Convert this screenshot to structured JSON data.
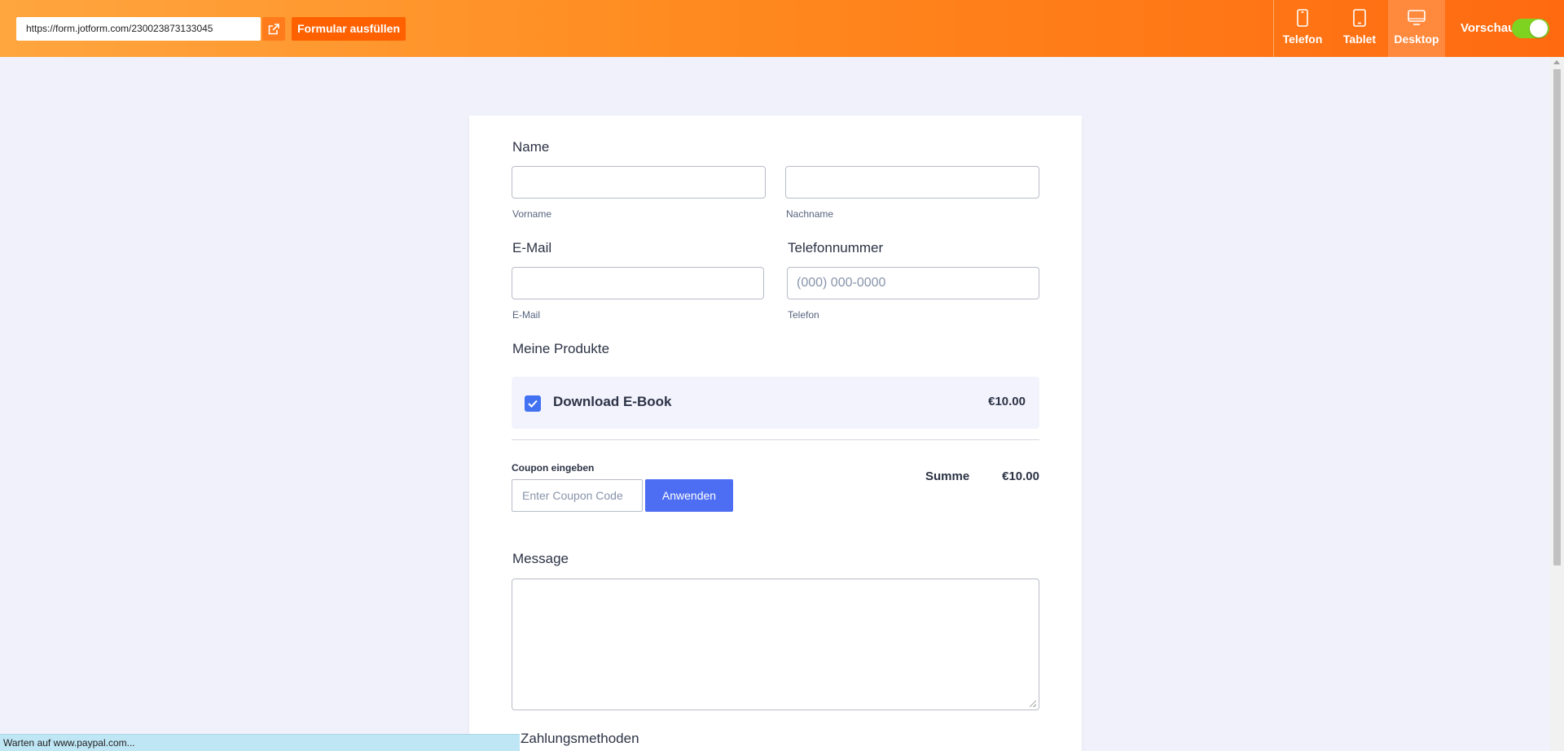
{
  "topbar": {
    "url": "https://form.jotform.com/230023873133045",
    "fill_button": "Formular ausfüllen",
    "devices": [
      {
        "label": "Telefon",
        "icon": "phone-icon",
        "active": false
      },
      {
        "label": "Tablet",
        "icon": "tablet-icon",
        "active": false
      },
      {
        "label": "Desktop",
        "icon": "desktop-icon",
        "active": true
      }
    ],
    "preview_label": "Vorschau",
    "preview_on": true,
    "colors": {
      "gradient_start": "#ffa63f",
      "gradient_end": "#ff6a10",
      "toggle_on": "#7ed321"
    }
  },
  "form": {
    "name": {
      "label": "Name",
      "first_sublabel": "Vorname",
      "last_sublabel": "Nachname",
      "first_value": "",
      "last_value": ""
    },
    "email": {
      "label": "E-Mail",
      "sublabel": "E-Mail",
      "value": ""
    },
    "phone": {
      "label": "Telefonnummer",
      "placeholder": "(000) 000-0000",
      "sublabel": "Telefon"
    },
    "products": {
      "label": "Meine Produkte",
      "items": [
        {
          "name": "Download E-Book",
          "price": "€10.00",
          "checked": true
        }
      ]
    },
    "coupon": {
      "label": "Coupon eingeben",
      "placeholder": "Enter Coupon Code",
      "apply_button": "Anwenden"
    },
    "summary": {
      "label": "Summe",
      "value": "€10.00"
    },
    "message": {
      "label": "Message",
      "value": ""
    },
    "payment": {
      "label": "Zahlungsmethoden"
    },
    "colors": {
      "accent": "#4d6ef2",
      "checkbox": "#4272f2"
    }
  },
  "status_bar": {
    "text": "Warten auf www.paypal.com..."
  }
}
